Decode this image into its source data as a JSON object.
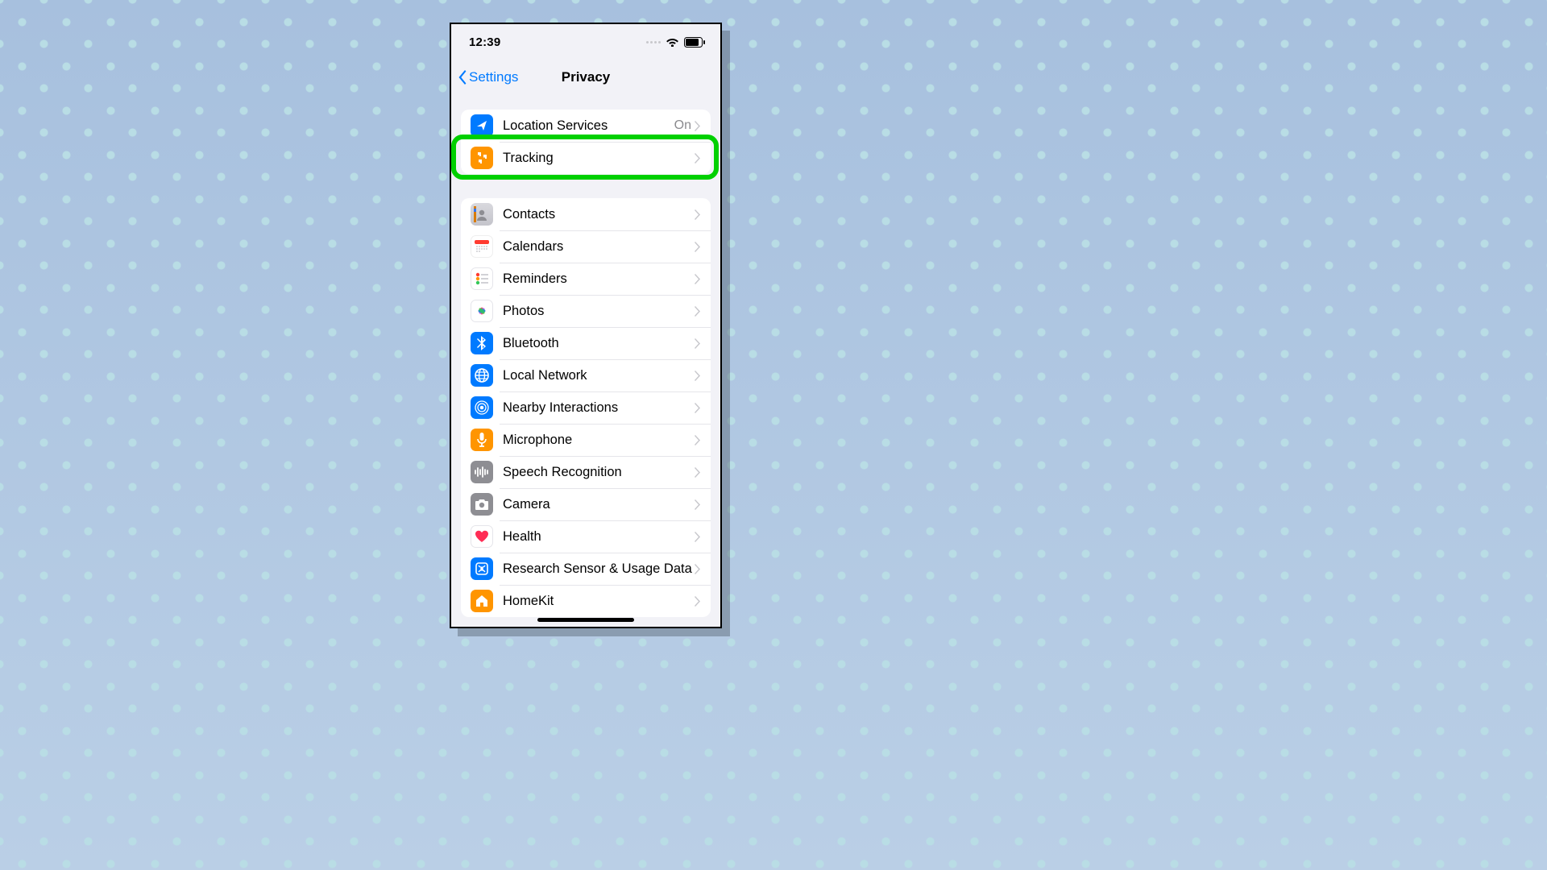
{
  "status": {
    "time": "12:39"
  },
  "nav": {
    "back": "Settings",
    "title": "Privacy"
  },
  "group1": [
    {
      "key": "location",
      "label": "Location Services",
      "value": "On"
    },
    {
      "key": "tracking",
      "label": "Tracking"
    }
  ],
  "group2": [
    {
      "key": "contacts",
      "label": "Contacts"
    },
    {
      "key": "calendars",
      "label": "Calendars"
    },
    {
      "key": "reminders",
      "label": "Reminders"
    },
    {
      "key": "photos",
      "label": "Photos"
    },
    {
      "key": "bluetooth",
      "label": "Bluetooth"
    },
    {
      "key": "localnet",
      "label": "Local Network"
    },
    {
      "key": "nearby",
      "label": "Nearby Interactions"
    },
    {
      "key": "mic",
      "label": "Microphone"
    },
    {
      "key": "speech",
      "label": "Speech Recognition"
    },
    {
      "key": "camera",
      "label": "Camera"
    },
    {
      "key": "health",
      "label": "Health"
    },
    {
      "key": "research",
      "label": "Research Sensor & Usage Data"
    },
    {
      "key": "homekit",
      "label": "HomeKit"
    }
  ],
  "colors": {
    "link": "#007aff",
    "highlight": "#00d000"
  }
}
